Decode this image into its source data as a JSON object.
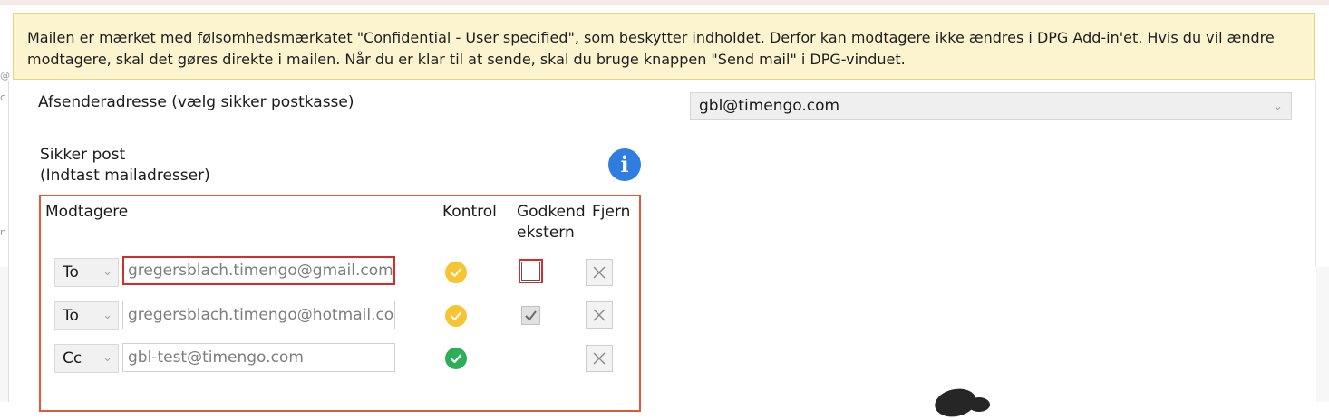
{
  "banner": {
    "line1": "Mailen er mærket med følsomhedsmærkatet \"Confidential - User specified\", som beskytter indholdet. Derfor kan modtagere ikke ændres i DPG Add-in'et. Hvis du vil ændre",
    "line2": "modtagere, skal det gøres direkte i mailen. Når du er klar til at sende, skal du bruge knappen \"Send mail\" i DPG-vinduet."
  },
  "sender": {
    "label": "Afsenderadresse (vælg sikker postkasse)",
    "value": "gbl@timengo.com"
  },
  "secure": {
    "line1": "Sikker post",
    "line2": "(Indtast mailadresser)"
  },
  "table": {
    "headers": {
      "recipients": "Modtagere",
      "check": "Kontrol",
      "approve_line1": "Godkend",
      "approve_line2": "ekstern",
      "remove": "Fjern"
    },
    "rows": [
      {
        "type": "To",
        "email": "gregersblach.timengo@gmail.com",
        "status": "warning",
        "approve_external": false
      },
      {
        "type": "To",
        "email": "gregersblach.timengo@hotmail.com",
        "status": "warning",
        "approve_external": true
      },
      {
        "type": "Cc",
        "email": "gbl-test@timengo.com",
        "status": "ok",
        "approve_external": null
      }
    ]
  },
  "icons": {
    "info": "info-icon",
    "chevron": "chevron-down-icon",
    "status_warning": "status-warning-icon",
    "status_ok": "status-ok-icon",
    "remove": "close-icon",
    "checkmark": "checkmark-icon"
  },
  "colors": {
    "banner_bg": "#fcf3cf",
    "banner_border": "#e8d37e",
    "box_border": "#e05a3a",
    "highlight": "#d82c2c",
    "info": "#2f7de1",
    "warning": "#f7c534",
    "ok": "#2eaf57"
  }
}
